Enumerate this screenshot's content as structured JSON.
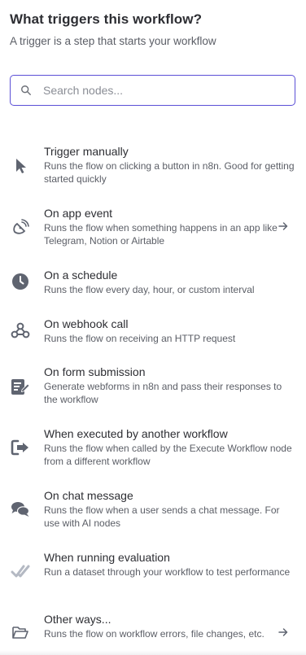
{
  "header": {
    "title": "What triggers this workflow?",
    "subtitle": "A trigger is a step that starts your workflow"
  },
  "search": {
    "placeholder": "Search nodes...",
    "value": ""
  },
  "items": [
    {
      "icon": "cursor-icon",
      "name": "Trigger manually",
      "desc": "Runs the flow on clicking a button in n8n. Good for getting started quickly",
      "arrow": false
    },
    {
      "icon": "satellite-dish-icon",
      "name": "On app event",
      "desc": "Runs the flow when something happens in an app like Telegram, Notion or Airtable",
      "arrow": true
    },
    {
      "icon": "clock-icon",
      "name": "On a schedule",
      "desc": "Runs the flow every day, hour, or custom interval",
      "arrow": false
    },
    {
      "icon": "webhook-icon",
      "name": "On webhook call",
      "desc": "Runs the flow on receiving an HTTP request",
      "arrow": false
    },
    {
      "icon": "form-icon",
      "name": "On form submission",
      "desc": "Generate webforms in n8n and pass their responses to the workflow",
      "arrow": false
    },
    {
      "icon": "sign-in-icon",
      "name": "When executed by another workflow",
      "desc": "Runs the flow when called by the Execute Workflow node from a different workflow",
      "arrow": false
    },
    {
      "icon": "chat-icon",
      "name": "On chat message",
      "desc": "Runs the flow when a user sends a chat message. For use with AI nodes",
      "arrow": false
    },
    {
      "icon": "check-double-icon",
      "name": "When running evaluation",
      "desc": "Run a dataset through your workflow to test performance",
      "arrow": false
    },
    {
      "icon": "folder-open-icon",
      "name": "Other ways...",
      "desc": "Runs the flow on workflow errors, file changes, etc.",
      "arrow": true
    }
  ],
  "colors": {
    "accent": "#5b4fd6",
    "icon": "#5f6470",
    "text": "#2d2e33",
    "muted": "#5b5e66"
  }
}
